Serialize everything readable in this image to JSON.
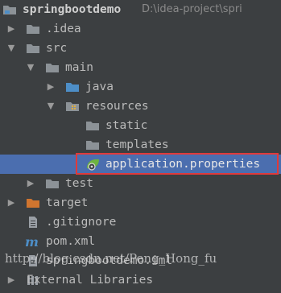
{
  "project": {
    "name": "springbootdemo",
    "path": "D:\\idea-project\\spri"
  },
  "tree": {
    "idea": ".idea",
    "src": "src",
    "main": "main",
    "java": "java",
    "resources": "resources",
    "static": "static",
    "templates": "templates",
    "application_properties": "application.properties",
    "test": "test",
    "target": "target",
    "gitignore": ".gitignore",
    "pom": "pom.xml",
    "iml": "springbootdemo.iml",
    "external_libraries": "External Libraries"
  },
  "selected_item": "application.properties",
  "watermark": "http://blog.csdn.net/Peng_Hong_fu",
  "colors": {
    "background": "#3c3f41",
    "selection": "#4b6eaf",
    "highlight_border": "#e03a3a",
    "folder_gray": "#8c9297",
    "folder_blue": "#4d8ec7",
    "folder_orange": "#d0752f",
    "spring_green": "#6db33f"
  }
}
